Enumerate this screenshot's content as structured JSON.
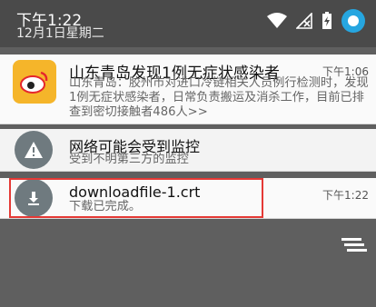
{
  "statusbar": {
    "time": "下午1:22",
    "date": "12月1日星期二"
  },
  "notifications": [
    {
      "title": "山东青岛发现1例无症状感染者",
      "time": "下午1:06",
      "body": "山东青岛：胶州市对进口冷链相关人员例行检测时，发现1例无症状感染者，日常负责搬运及消杀工作，目前已排查到密切接触者486人>>",
      "icon": "weibo-icon"
    },
    {
      "title": "网络可能会受到监控",
      "body": "受到不明第三方的监控",
      "icon": "warning-icon"
    },
    {
      "title": "downloadfile-1.crt",
      "time": "下午1:22",
      "body": "下载已完成。",
      "icon": "download-icon"
    }
  ]
}
